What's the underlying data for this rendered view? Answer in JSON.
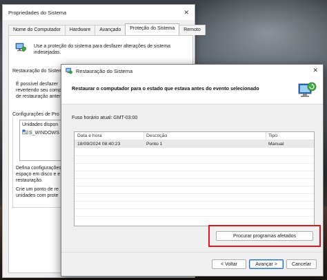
{
  "background_window": {
    "title": "Propriedades do Sistema",
    "close_glyph": "✕",
    "tabs": [
      {
        "label": "Nome do Computador",
        "active": false
      },
      {
        "label": "Hardware",
        "active": false
      },
      {
        "label": "Avançado",
        "active": false
      },
      {
        "label": "Proteção do Sistema",
        "active": true
      },
      {
        "label": "Remoto",
        "active": false
      }
    ],
    "intro_line1": "Use a proteção do sistema para desfazer alterações de sistema",
    "intro_line2": "indesejadas.",
    "restore_section_label": "Restauração do Sistem",
    "restore_desc_line1": "É possível desfazer",
    "restore_desc_line2": "revertendo seu compt",
    "restore_desc_line3": "de restauração anter",
    "config_section_label": "Configurações de Pro",
    "drives_header": "Unidades dispon",
    "drive_label": "S_WINDOWS",
    "config_desc_line1": "Defina configurações",
    "config_desc_line2": "espaço em disco e e",
    "config_desc_line3": "restauração.",
    "create_desc_line1": "Crie um ponto de re",
    "create_desc_line2": "unidades com prote",
    "icons": [
      "computer-shield-icon",
      "drive-icon"
    ]
  },
  "dialog": {
    "title": "Restauração do Sistema",
    "close_glyph": "✕",
    "heading": "Restaurar o computador para o estado que estava antes do evento selecionado",
    "timezone": "Fuso horário atual: GMT-03:00",
    "table": {
      "columns": [
        "Data e hora",
        "Descrição",
        "Tipo"
      ],
      "rows": [
        {
          "date": "18/09/2024 08:40:23",
          "description": "Ponto 1",
          "type": "Manual"
        }
      ]
    },
    "scan_button": "Procurar programas afetados",
    "back_button": "< Voltar",
    "next_button": "Avançar >",
    "cancel_button": "Cancelar",
    "highlight_color": "#e0161d",
    "accent_color": "#2c6fd1",
    "icons": [
      "system-restore-icon",
      "restore-header-icon"
    ]
  }
}
